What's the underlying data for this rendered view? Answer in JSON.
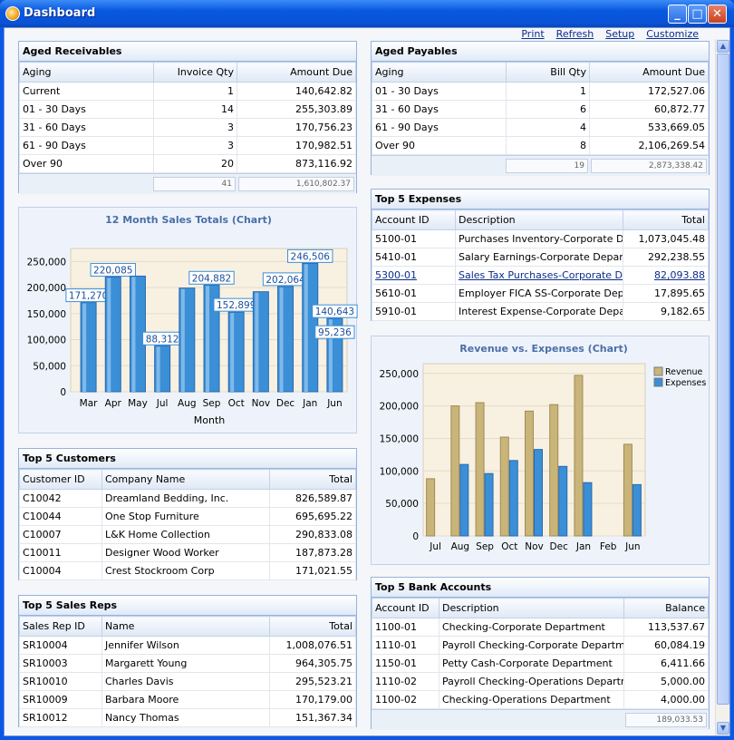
{
  "window": {
    "title": "Dashboard",
    "minimize": "_",
    "maximize": "□",
    "close": "✕"
  },
  "links": [
    "Print",
    "Refresh",
    "Setup",
    "Customize"
  ],
  "aged_receivables": {
    "title": "Aged Receivables",
    "headers": [
      "Aging",
      "Invoice Qty",
      "Amount Due"
    ],
    "rows": [
      [
        "Current",
        "1",
        "140,642.82"
      ],
      [
        "01 - 30 Days",
        "14",
        "255,303.89"
      ],
      [
        "31 - 60 Days",
        "3",
        "170,756.23"
      ],
      [
        "61 - 90 Days",
        "3",
        "170,982.51"
      ],
      [
        "Over 90",
        "20",
        "873,116.92"
      ]
    ],
    "totals": [
      "41",
      "1,610,802.37"
    ]
  },
  "aged_payables": {
    "title": "Aged Payables",
    "headers": [
      "Aging",
      "Bill Qty",
      "Amount Due"
    ],
    "rows": [
      [
        "01 - 30 Days",
        "1",
        "172,527.06"
      ],
      [
        "31 - 60 Days",
        "6",
        "60,872.77"
      ],
      [
        "61 - 90 Days",
        "4",
        "533,669.05"
      ],
      [
        "Over 90",
        "8",
        "2,106,269.54"
      ]
    ],
    "totals": [
      "19",
      "2,873,338.42"
    ]
  },
  "top_expenses": {
    "title": "Top 5 Expenses",
    "headers": [
      "Account ID",
      "Description",
      "Total"
    ],
    "rows": [
      [
        "5100-01",
        "Purchases Inventory-Corporate Depa",
        "1,073,045.48"
      ],
      [
        "5410-01",
        "Salary Earnings-Corporate Departmer",
        "292,238.55"
      ],
      [
        "5300-01",
        "Sales Tax Purchases-Corporate Depa",
        "82,093.88"
      ],
      [
        "5610-01",
        "Employer FICA SS-Corporate Departn",
        "17,895.65"
      ],
      [
        "5910-01",
        "Interest Expense-Corporate Departm",
        "9,182.65"
      ]
    ]
  },
  "top_customers": {
    "title": "Top 5 Customers",
    "headers": [
      "Customer ID",
      "Company Name",
      "Total"
    ],
    "rows": [
      [
        "C10042",
        "Dreamland Bedding, Inc.",
        "826,589.87"
      ],
      [
        "C10044",
        "One Stop Furniture",
        "695,695.22"
      ],
      [
        "C10007",
        "L&K Home Collection",
        "290,833.08"
      ],
      [
        "C10011",
        "Designer Wood Worker",
        "187,873.28"
      ],
      [
        "C10004",
        "Crest Stockroom Corp",
        "171,021.55"
      ]
    ]
  },
  "top_sales_reps": {
    "title": "Top 5 Sales Reps",
    "headers": [
      "Sales Rep ID",
      "Name",
      "Total"
    ],
    "rows": [
      [
        "SR10004",
        "Jennifer  Wilson",
        "1,008,076.51"
      ],
      [
        "SR10003",
        "Margarett Young",
        "964,305.75"
      ],
      [
        "SR10010",
        "Charles Davis",
        "295,523.21"
      ],
      [
        "SR10009",
        "Barbara Moore",
        "170,179.00"
      ],
      [
        "SR10012",
        "Nancy  Thomas",
        "151,367.34"
      ]
    ]
  },
  "top_bank_accounts": {
    "title": "Top 5 Bank Accounts",
    "headers": [
      "Account ID",
      "Description",
      "Balance"
    ],
    "rows": [
      [
        "1100-01",
        "Checking-Corporate Department",
        "113,537.67"
      ],
      [
        "1110-01",
        "Payroll Checking-Corporate Department",
        "60,084.19"
      ],
      [
        "1150-01",
        "Petty Cash-Corporate Department",
        "6,411.66"
      ],
      [
        "1110-02",
        "Payroll Checking-Operations Department",
        "5,000.00"
      ],
      [
        "1100-02",
        "Checking-Operations Department",
        "4,000.00"
      ]
    ],
    "total": "189,033.53"
  },
  "chart_data": [
    {
      "type": "bar",
      "title": "12 Month Sales Totals (Chart)",
      "xlabel": "Month",
      "ylabel": "",
      "ylim": [
        0,
        275000
      ],
      "yticks": [
        "0",
        "50,000",
        "100,000",
        "150,000",
        "200,000",
        "250,000"
      ],
      "categories": [
        "Mar",
        "Apr",
        "May",
        "Jul",
        "Aug",
        "Sep",
        "Oct",
        "Nov",
        "Dec",
        "Jan",
        "Jun"
      ],
      "values": [
        171270,
        220085,
        222000,
        88312,
        199000,
        204882,
        152899,
        192000,
        202064,
        246506,
        140643
      ],
      "data_labels": [
        "171,270",
        "220,085",
        "",
        "88,312",
        "",
        "204,882",
        "152,899",
        "",
        "202,064",
        "246,506",
        "140,643"
      ],
      "extra_label": "95,236",
      "color": "#3b8fd6",
      "grid": true
    },
    {
      "type": "bar",
      "title": "Revenue vs. Expenses (Chart)",
      "ylim": [
        0,
        265000
      ],
      "yticks": [
        "0",
        "50,000",
        "100,000",
        "150,000",
        "200,000",
        "250,000"
      ],
      "categories": [
        "Jul",
        "Aug",
        "Sep",
        "Oct",
        "Nov",
        "Dec",
        "Jan",
        "Feb",
        "Jun"
      ],
      "series": [
        {
          "name": "Revenue",
          "color": "#c9b47a",
          "values": [
            88000,
            200000,
            205000,
            152000,
            192000,
            202000,
            247000,
            0,
            141000
          ]
        },
        {
          "name": "Expenses",
          "color": "#3b8fd6",
          "values": [
            0,
            110000,
            96000,
            116000,
            133000,
            107000,
            82000,
            0,
            79000
          ]
        }
      ],
      "legend": "top-right",
      "grid": true
    }
  ]
}
